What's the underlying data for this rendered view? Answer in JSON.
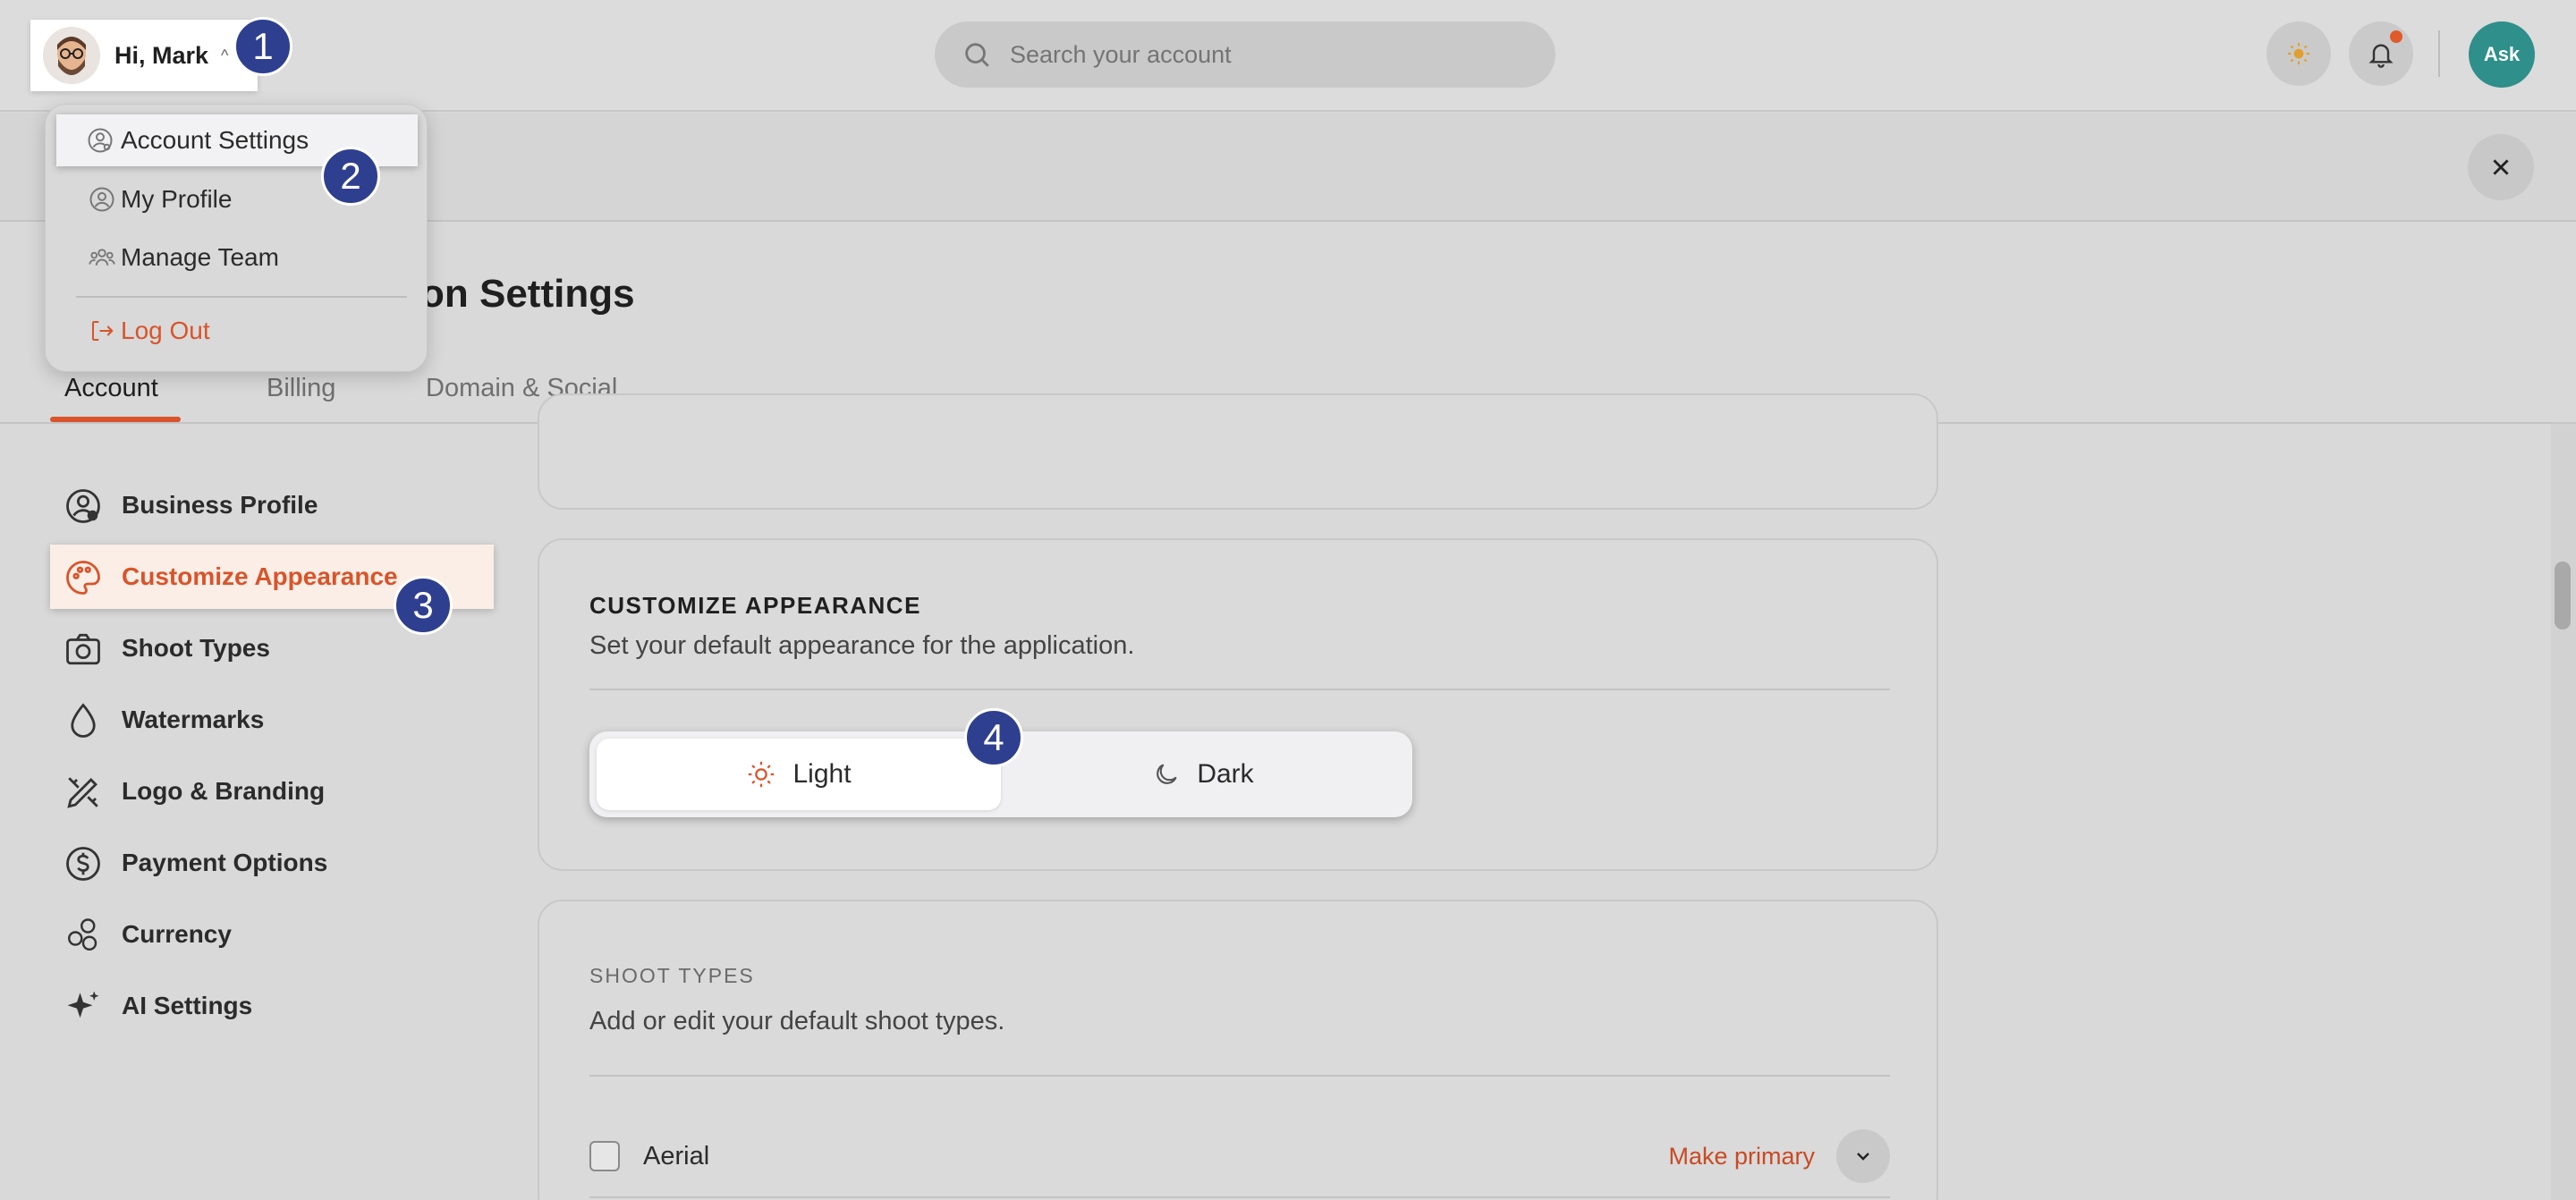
{
  "header": {
    "greeting": "Hi, Mark",
    "search_placeholder": "Search your account",
    "ask_label": "Ask"
  },
  "badges": [
    "1",
    "2",
    "3",
    "4"
  ],
  "user_menu": {
    "items": [
      {
        "label": "Account Settings",
        "icon": "user-gear-icon"
      },
      {
        "label": "My Profile",
        "icon": "user-circle-icon"
      },
      {
        "label": "Manage Team",
        "icon": "team-icon"
      }
    ],
    "logout": "Log Out"
  },
  "page": {
    "title_visible": "on Settings",
    "tabs": [
      "Account",
      "Billing",
      "Domain & Social"
    ],
    "active_tab": "Account"
  },
  "sidebar": {
    "items": [
      {
        "label": "Business Profile",
        "icon": "user-gear-icon"
      },
      {
        "label": "Customize Appearance",
        "icon": "palette-icon"
      },
      {
        "label": "Shoot Types",
        "icon": "camera-icon"
      },
      {
        "label": "Watermarks",
        "icon": "droplet-icon"
      },
      {
        "label": "Logo & Branding",
        "icon": "pen-ruler-icon"
      },
      {
        "label": "Payment Options",
        "icon": "dollar-circle-icon"
      },
      {
        "label": "Currency",
        "icon": "coins-icon"
      },
      {
        "label": "AI Settings",
        "icon": "sparkle-icon"
      }
    ],
    "active": "Customize Appearance"
  },
  "appearance": {
    "heading": "CUSTOMIZE APPEARANCE",
    "subtitle": "Set your default appearance for the application.",
    "options": [
      {
        "label": "Light",
        "icon": "sun-icon"
      },
      {
        "label": "Dark",
        "icon": "moon-icon"
      }
    ],
    "selected": "Light"
  },
  "shoot_types": {
    "heading": "SHOOT TYPES",
    "subtitle": "Add or edit your default shoot types.",
    "rows": [
      {
        "label": "Aerial",
        "action": "Make primary"
      }
    ]
  },
  "colors": {
    "accent": "#d9542a",
    "badge": "#2f3f8f",
    "ask": "#2f8f8a"
  }
}
